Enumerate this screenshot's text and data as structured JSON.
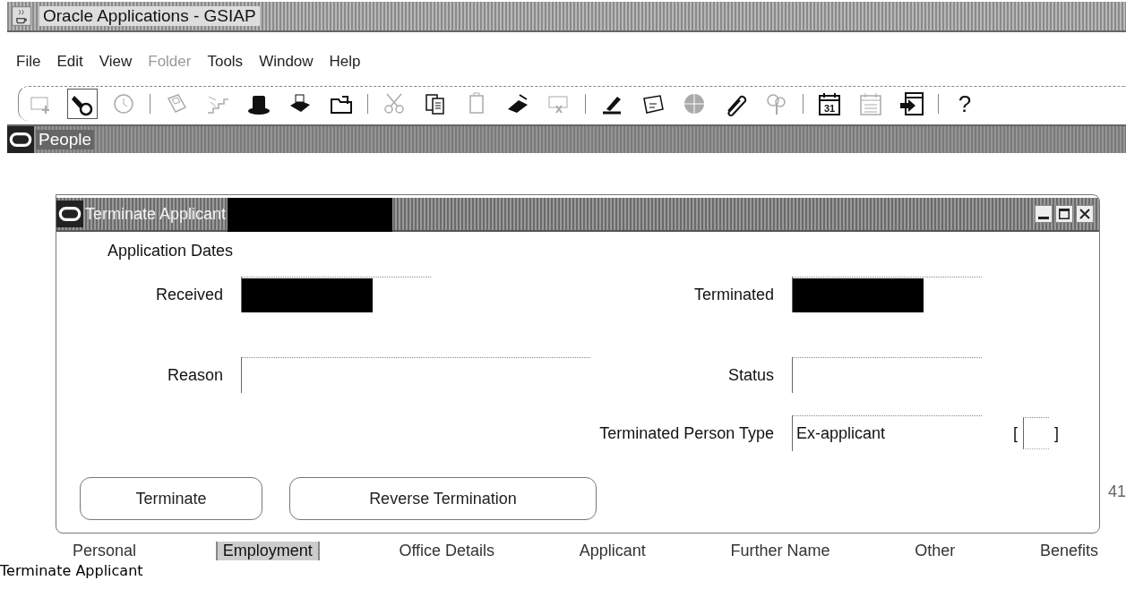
{
  "window": {
    "title": "Oracle Applications - GSIAP"
  },
  "menu": [
    {
      "label": "File",
      "disabled": false
    },
    {
      "label": "Edit",
      "disabled": false
    },
    {
      "label": "View",
      "disabled": false
    },
    {
      "label": "Folder",
      "disabled": true
    },
    {
      "label": "Tools",
      "disabled": false
    },
    {
      "label": "Window",
      "disabled": false
    },
    {
      "label": "Help",
      "disabled": false
    }
  ],
  "toolbar": [
    {
      "kind": "new",
      "disabled": true,
      "pressed": false
    },
    {
      "kind": "find",
      "disabled": false,
      "pressed": true
    },
    {
      "kind": "clock",
      "disabled": true,
      "pressed": false
    },
    {
      "kind": "separator"
    },
    {
      "kind": "save",
      "disabled": true,
      "pressed": false
    },
    {
      "kind": "steps",
      "disabled": true,
      "pressed": false
    },
    {
      "kind": "hat",
      "disabled": false,
      "pressed": false
    },
    {
      "kind": "print",
      "disabled": false,
      "pressed": false
    },
    {
      "kind": "folder",
      "disabled": false,
      "pressed": false
    },
    {
      "kind": "separator"
    },
    {
      "kind": "cut",
      "disabled": true,
      "pressed": false
    },
    {
      "kind": "copy",
      "disabled": false,
      "pressed": false
    },
    {
      "kind": "paste",
      "disabled": true,
      "pressed": false
    },
    {
      "kind": "eraser",
      "disabled": false,
      "pressed": false
    },
    {
      "kind": "delete",
      "disabled": true,
      "pressed": false
    },
    {
      "kind": "separator"
    },
    {
      "kind": "pen",
      "disabled": false,
      "pressed": false
    },
    {
      "kind": "card",
      "disabled": false,
      "pressed": false
    },
    {
      "kind": "globe",
      "disabled": true,
      "pressed": false
    },
    {
      "kind": "clip",
      "disabled": false,
      "pressed": false
    },
    {
      "kind": "tree",
      "disabled": true,
      "pressed": false
    },
    {
      "kind": "separator"
    },
    {
      "kind": "calendar",
      "label": "31",
      "disabled": false,
      "pressed": false
    },
    {
      "kind": "calendar-blank",
      "disabled": true,
      "pressed": false
    },
    {
      "kind": "exit",
      "disabled": false,
      "pressed": false
    },
    {
      "kind": "separator"
    },
    {
      "kind": "help",
      "label": "?",
      "disabled": false,
      "pressed": false
    }
  ],
  "people_window": {
    "title": "People",
    "side_value": "41",
    "tabs": [
      {
        "label": "Personal",
        "selected": false
      },
      {
        "label": "Employment",
        "selected": true
      },
      {
        "label": "Office Details",
        "selected": false
      },
      {
        "label": "Applicant",
        "selected": false
      },
      {
        "label": "Further Name",
        "selected": false
      },
      {
        "label": "Other",
        "selected": false
      },
      {
        "label": "Benefits",
        "selected": false
      }
    ]
  },
  "dialog": {
    "title": "Terminate Applicant",
    "title_redacted": true,
    "section": "Application Dates",
    "left_fields": [
      {
        "label": "Received",
        "redacted": true
      },
      {
        "label": "Reason"
      }
    ],
    "right_fields": [
      {
        "label": "Terminated",
        "redacted": true
      },
      {
        "label": "Status"
      },
      {
        "label": "Terminated Person Type",
        "value": "Ex-applicant"
      }
    ],
    "flexfield": {
      "open": "[",
      "close": "]"
    },
    "buttons": [
      {
        "label": "Terminate"
      },
      {
        "label": "Reverse Termination"
      }
    ]
  },
  "caption": "Terminate Applicant"
}
